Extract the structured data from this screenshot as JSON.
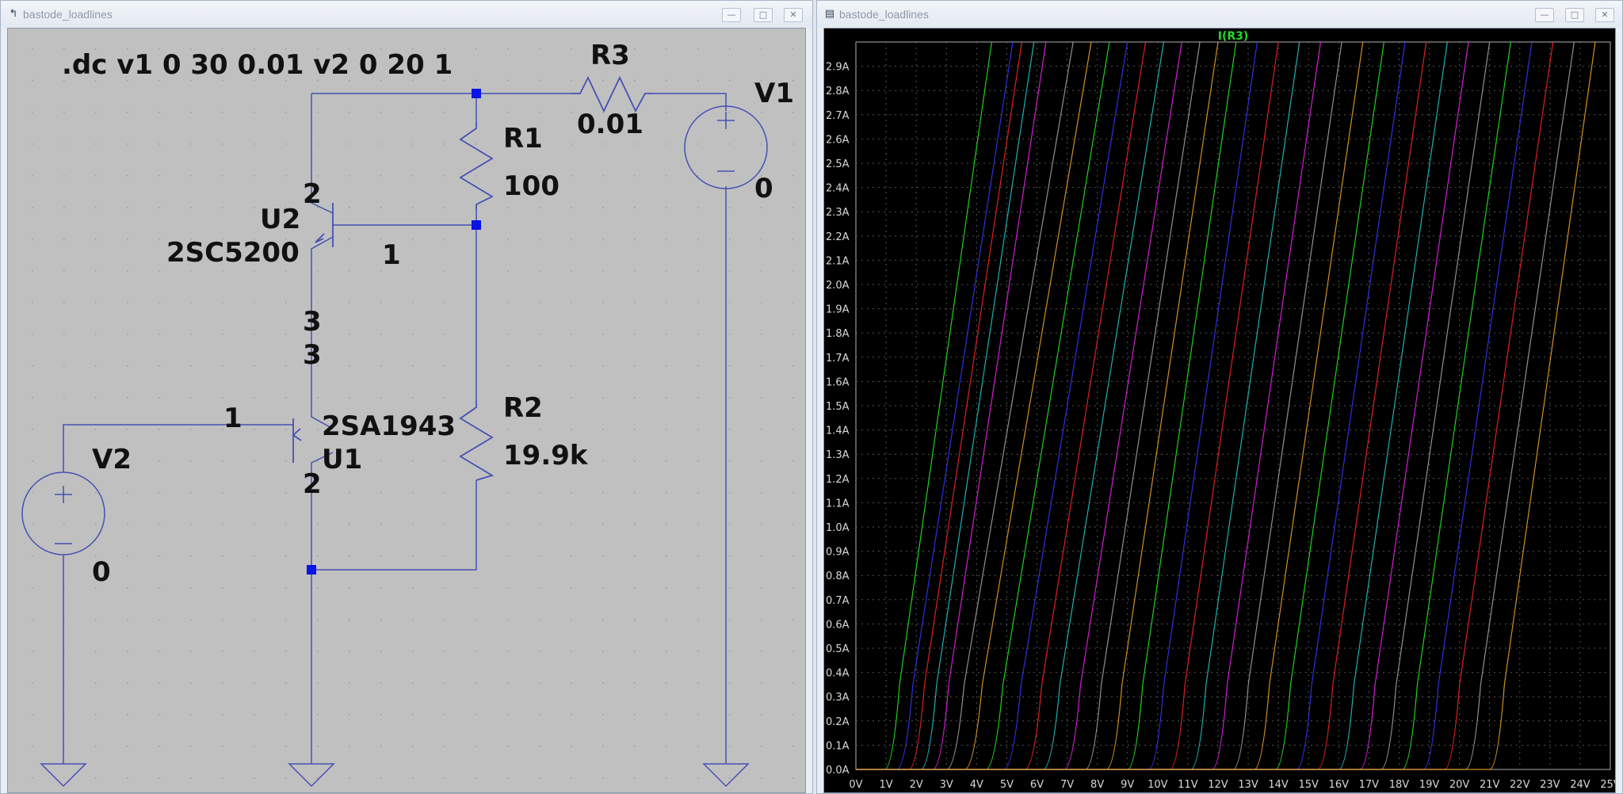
{
  "left_window": {
    "title": "bastode_loadlines",
    "controls": {
      "minimize": "—",
      "maximize": "□",
      "close": "✕"
    },
    "icon": "ltspice-schematic-icon"
  },
  "right_window": {
    "title": "bastode_loadlines",
    "controls": {
      "minimize": "—",
      "maximize": "□",
      "close": "✕"
    },
    "icon": "waveform-viewer-icon"
  },
  "schematic": {
    "directive": ".dc v1 0 30 0.01 v2 0 20 1",
    "r3": {
      "name": "R3",
      "value": "0.01"
    },
    "r1": {
      "name": "R1",
      "value": "100"
    },
    "r2": {
      "name": "R2",
      "value": "19.9k"
    },
    "v1": {
      "name": "V1",
      "value": "0"
    },
    "v2": {
      "name": "V2",
      "value": "0"
    },
    "u2": {
      "name": "U2",
      "model": "2SC5200",
      "pin_collector": "2",
      "pin_base": "1",
      "pin_emitter": "3"
    },
    "u1": {
      "name": "U1",
      "model": "2SA1943",
      "pin_emitter": "3",
      "pin_base": "1",
      "pin_collector": "2"
    },
    "colors": {
      "background": "#c0c0c0",
      "wire": "#4650b4",
      "junction": "#0a14e6",
      "text": "#111111",
      "grid_dot": "#9a9a9a"
    }
  },
  "plot": {
    "title": "I(R3)",
    "title_color": "#22dd22",
    "background": "#000000",
    "grid_color": "#555555",
    "tick_color": "#d8d8d8",
    "x_ticks": [
      "0V",
      "1V",
      "2V",
      "3V",
      "4V",
      "5V",
      "6V",
      "7V",
      "8V",
      "9V",
      "10V",
      "11V",
      "12V",
      "13V",
      "14V",
      "15V",
      "16V",
      "17V",
      "18V",
      "19V",
      "20V",
      "21V",
      "22V",
      "23V",
      "24V",
      "25V"
    ],
    "y_ticks": [
      "0.0A",
      "0.1A",
      "0.2A",
      "0.3A",
      "0.4A",
      "0.5A",
      "0.6A",
      "0.7A",
      "0.8A",
      "0.9A",
      "1.0A",
      "1.1A",
      "1.2A",
      "1.3A",
      "1.4A",
      "1.5A",
      "1.6A",
      "1.7A",
      "1.8A",
      "1.9A",
      "2.0A",
      "2.1A",
      "2.2A",
      "2.3A",
      "2.4A",
      "2.5A",
      "2.6A",
      "2.7A",
      "2.8A",
      "2.9A"
    ]
  },
  "chart_data": {
    "type": "line",
    "title": "I(R3)",
    "xlabel": "",
    "ylabel": "",
    "xlim": [
      0,
      25
    ],
    "ylim": [
      0,
      3.0
    ],
    "grid": true,
    "series_model": "each trace: I = 0 until x = x_onset, then rises with curved knee and steep near-linear slope to the top of the plot",
    "series": [
      {
        "x_onset": 0.95,
        "x_top": 4.5,
        "color": "#20d020"
      },
      {
        "x_onset": 1.35,
        "x_top": 5.2,
        "color": "#3030e0"
      },
      {
        "x_onset": 1.75,
        "x_top": 5.5,
        "color": "#dd2020"
      },
      {
        "x_onset": 2.15,
        "x_top": 5.9,
        "color": "#20b0b0"
      },
      {
        "x_onset": 2.55,
        "x_top": 6.3,
        "color": "#d020d0"
      },
      {
        "x_onset": 3.0,
        "x_top": 7.2,
        "color": "#909090"
      },
      {
        "x_onset": 3.6,
        "x_top": 7.8,
        "color": "#d09020"
      },
      {
        "x_onset": 4.3,
        "x_top": 8.4,
        "color": "#20d020"
      },
      {
        "x_onset": 4.9,
        "x_top": 9.0,
        "color": "#3030e0"
      },
      {
        "x_onset": 5.6,
        "x_top": 9.6,
        "color": "#dd2020"
      },
      {
        "x_onset": 6.2,
        "x_top": 10.2,
        "color": "#20b0b0"
      },
      {
        "x_onset": 6.9,
        "x_top": 10.8,
        "color": "#d020d0"
      },
      {
        "x_onset": 7.6,
        "x_top": 11.4,
        "color": "#909090"
      },
      {
        "x_onset": 8.3,
        "x_top": 12.0,
        "color": "#d09020"
      },
      {
        "x_onset": 9.0,
        "x_top": 12.6,
        "color": "#20d020"
      },
      {
        "x_onset": 9.7,
        "x_top": 13.3,
        "color": "#3030e0"
      },
      {
        "x_onset": 10.4,
        "x_top": 14.0,
        "color": "#dd2020"
      },
      {
        "x_onset": 11.1,
        "x_top": 14.7,
        "color": "#20b0b0"
      },
      {
        "x_onset": 11.8,
        "x_top": 15.4,
        "color": "#d020d0"
      },
      {
        "x_onset": 12.5,
        "x_top": 16.1,
        "color": "#909090"
      },
      {
        "x_onset": 13.2,
        "x_top": 16.8,
        "color": "#d09020"
      },
      {
        "x_onset": 13.9,
        "x_top": 17.5,
        "color": "#20d020"
      },
      {
        "x_onset": 14.6,
        "x_top": 18.2,
        "color": "#3030e0"
      },
      {
        "x_onset": 15.3,
        "x_top": 18.9,
        "color": "#dd2020"
      },
      {
        "x_onset": 16.0,
        "x_top": 19.6,
        "color": "#20b0b0"
      },
      {
        "x_onset": 16.7,
        "x_top": 20.3,
        "color": "#d020d0"
      },
      {
        "x_onset": 17.4,
        "x_top": 21.0,
        "color": "#909090"
      },
      {
        "x_onset": 18.1,
        "x_top": 21.7,
        "color": "#20d020"
      },
      {
        "x_onset": 18.8,
        "x_top": 22.4,
        "color": "#3030e0"
      },
      {
        "x_onset": 19.5,
        "x_top": 23.1,
        "color": "#dd2020"
      },
      {
        "x_onset": 20.2,
        "x_top": 23.8,
        "color": "#909090"
      },
      {
        "x_onset": 21.0,
        "x_top": 24.5,
        "color": "#d09020"
      }
    ]
  }
}
